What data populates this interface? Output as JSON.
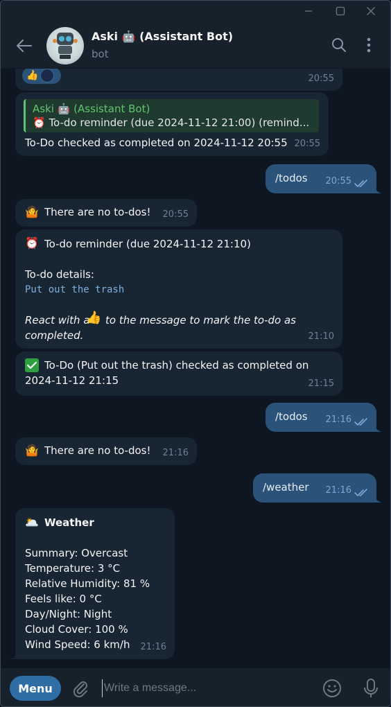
{
  "chat": {
    "title": "Aski 🤖 (Assistant Bot)",
    "subtitle": "bot"
  },
  "messages": {
    "m0": {
      "time": "20:55"
    },
    "m1": {
      "reply_name": "Aski 🤖 (Assistant Bot)",
      "reply_text": "⏰ To-do reminder (due 2024-11-12 21:00) (remind...",
      "text": "To-Do checked as completed on 2024-11-12 20:55",
      "time": "20:55"
    },
    "m2": {
      "text": "/todos",
      "time": "20:55"
    },
    "m3": {
      "text": "There are no to-dos!",
      "time": "20:55"
    },
    "m4": {
      "line1": "To-do reminder (due 2024-11-12 21:10)",
      "line2": "To-do details:",
      "code": "Put out the trash",
      "italic1": "React with a",
      "italic2": "to the message to mark the to-do as",
      "italic3": "completed.",
      "time": "21:10"
    },
    "m5": {
      "line1": "To-Do (Put out the trash) checked as completed on",
      "line2": "2024-11-12 21:15",
      "time": "21:15"
    },
    "m6": {
      "text": "/todos",
      "time": "21:16"
    },
    "m7": {
      "text": "There are no to-dos!",
      "time": "21:16"
    },
    "m8": {
      "text": "/weather",
      "time": "21:16"
    },
    "m9": {
      "title": "Weather",
      "lines": [
        "Summary: Overcast",
        "Temperature: 3 °C",
        "Relative Humidity: 81 %",
        "Feels like: 0 °C",
        "Day/Night: Night",
        "Cloud Cover: 100 %",
        "Wind Speed: 6 km/h"
      ],
      "time": "21:16"
    }
  },
  "composer": {
    "menu_label": "Menu",
    "placeholder": "Write a message..."
  },
  "colors": {
    "background": "#0e1621",
    "incoming": "#182533",
    "outgoing": "#2b5278",
    "accent": "#2f6ea5"
  }
}
